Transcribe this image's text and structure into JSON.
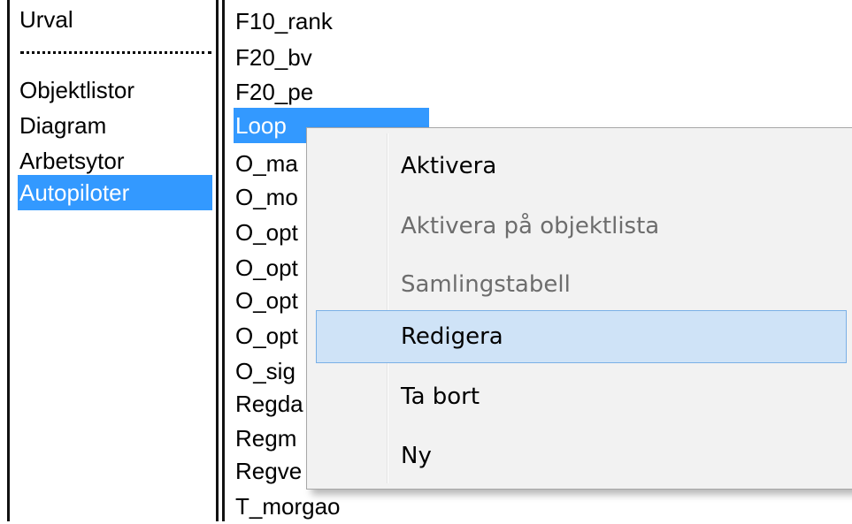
{
  "left_panel": {
    "items": [
      {
        "label": "Urval",
        "selected": false
      },
      {
        "label": "Objektlistor",
        "selected": false
      },
      {
        "label": "Diagram",
        "selected": false
      },
      {
        "label": "Arbetsytor",
        "selected": false
      },
      {
        "label": "Autopiloter",
        "selected": true
      }
    ]
  },
  "right_panel": {
    "items": [
      {
        "label": "F10_rank"
      },
      {
        "label": "F20_bv"
      },
      {
        "label": "F20_pe"
      },
      {
        "label": "Loop",
        "selected": true
      },
      {
        "label": "O_ma"
      },
      {
        "label": "O_mo"
      },
      {
        "label": "O_opt"
      },
      {
        "label": "O_opt"
      },
      {
        "label": "O_opt"
      },
      {
        "label": "O_opt"
      },
      {
        "label": "O_sig"
      },
      {
        "label": "Regda"
      },
      {
        "label": "Regm"
      },
      {
        "label": "Regve"
      },
      {
        "label": "T_morgao"
      }
    ]
  },
  "context_menu": {
    "items": [
      {
        "label": "Aktivera",
        "enabled": true
      },
      {
        "label": "Aktivera på objektlista",
        "enabled": false
      },
      {
        "label": "Samlingstabell",
        "enabled": false
      },
      {
        "label": "Redigera",
        "enabled": true,
        "highlighted": true
      },
      {
        "label": "Ta bort",
        "enabled": true
      },
      {
        "label": "Ny",
        "enabled": true
      }
    ]
  },
  "colors": {
    "selection": "#3399ff",
    "menu_background": "#f2f2f2",
    "menu_highlight": "#cfe3f7",
    "menu_highlight_border": "#7ab0e6",
    "disabled_text": "#6d6d6d"
  }
}
